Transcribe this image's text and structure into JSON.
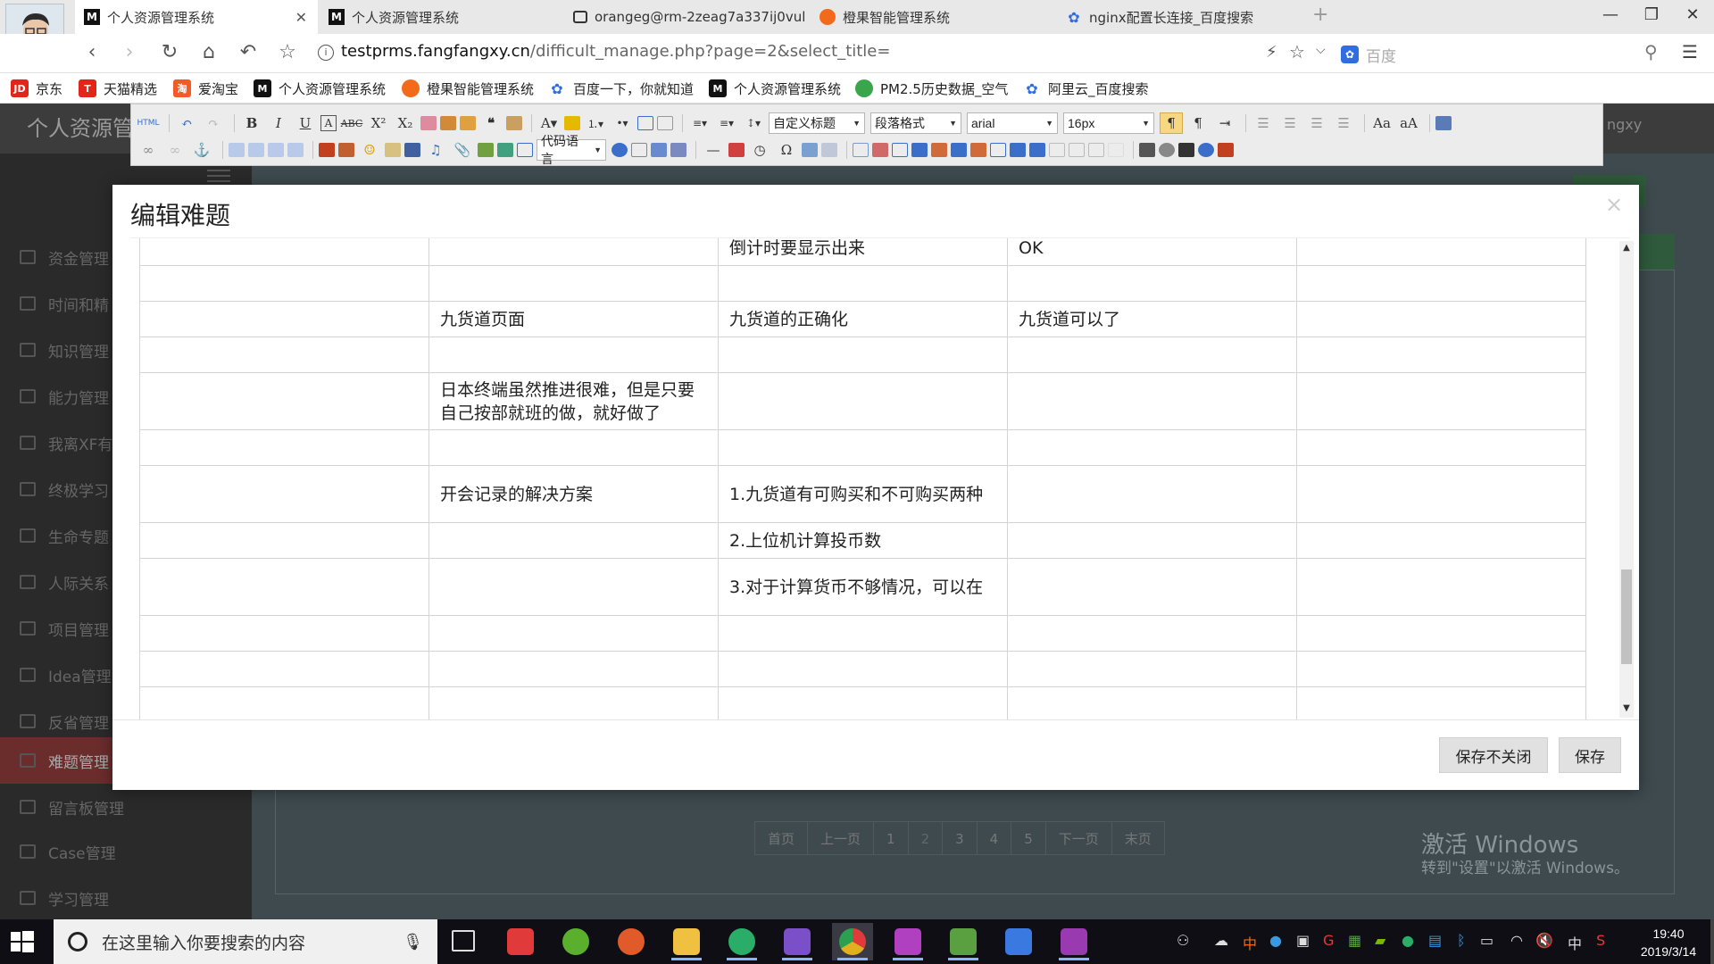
{
  "browser": {
    "tabs": [
      {
        "title": "个人资源管理系统",
        "icon": "m-logo-icon",
        "active": true
      },
      {
        "title": "个人资源管理系统",
        "icon": "m-logo-icon",
        "active": false
      },
      {
        "title": "orangeg@rm-2zeag7a337ij0vul",
        "icon": "console-icon",
        "active": false
      },
      {
        "title": "橙果智能管理系统",
        "icon": "orange-icon",
        "active": false
      },
      {
        "title": "nginx配置长连接_百度搜索",
        "icon": "baidu-paw-icon",
        "active": false
      }
    ],
    "new_tab": "+",
    "url_host": "testprms.fangfangxy.cn",
    "url_path": "/difficult_manage.php?page=2&select_title=",
    "search_placeholder": "百度",
    "bookmarks": [
      {
        "label": "京东",
        "icon": "jd-icon",
        "color": "#e1251b"
      },
      {
        "label": "天猫精选",
        "icon": "tmall-icon",
        "color": "#e1251b"
      },
      {
        "label": "爱淘宝",
        "icon": "taobao-icon",
        "color": "#f25a29"
      },
      {
        "label": "个人资源管理系统",
        "icon": "m-logo-icon",
        "color": "#111111"
      },
      {
        "label": "橙果智能管理系统",
        "icon": "orange-icon",
        "color": "#f26a1b"
      },
      {
        "label": "百度一下，你就知道",
        "icon": "baidu-paw-icon",
        "color": "#2f6ee0"
      },
      {
        "label": "个人资源管理系统",
        "icon": "m-logo-icon",
        "color": "#111111"
      },
      {
        "label": "PM2.5历史数据_空气",
        "icon": "globe-icon",
        "color": "#3aa64b"
      },
      {
        "label": "阿里云_百度搜索",
        "icon": "baidu-paw-icon",
        "color": "#2f6ee0"
      }
    ]
  },
  "app": {
    "title": "个人资源管",
    "user": "ngxy",
    "sidebar": [
      {
        "label": "资金管理",
        "active": false
      },
      {
        "label": "时间和精",
        "active": false
      },
      {
        "label": "知识管理",
        "active": false
      },
      {
        "label": "能力管理",
        "active": false
      },
      {
        "label": "我离XF有",
        "active": false
      },
      {
        "label": "终极学习",
        "active": false
      },
      {
        "label": "生命专题",
        "active": false
      },
      {
        "label": "人际关系",
        "active": false
      },
      {
        "label": "项目管理",
        "active": false
      },
      {
        "label": "Idea管理",
        "active": false
      },
      {
        "label": "反省管理",
        "active": false
      },
      {
        "label": "难题管理",
        "active": true
      },
      {
        "label": "留言板管理",
        "active": false
      },
      {
        "label": "Case管理",
        "active": false
      },
      {
        "label": "学习管理",
        "active": false
      }
    ],
    "pager": [
      "首页",
      "上一页",
      "1",
      "2",
      "3",
      "4",
      "5",
      "下一页",
      "末页"
    ]
  },
  "editor": {
    "toolbar_selects": {
      "heading": "自定义标题",
      "paragraph": "段落格式",
      "font": "arial",
      "size": "16px",
      "code": "代码语言"
    }
  },
  "modal": {
    "title": "编辑难题",
    "close": "×",
    "rows": [
      [
        "",
        "",
        "倒计时要显示出来",
        "OK",
        ""
      ],
      [
        "",
        "",
        "",
        "",
        ""
      ],
      [
        "",
        "九货道页面",
        "九货道的正确化",
        "九货道可以了",
        ""
      ],
      [
        "",
        "",
        "",
        "",
        ""
      ],
      [
        "",
        "日本终端虽然推进很难，但是只要自己按部就班的做，就好做了",
        "",
        "",
        ""
      ],
      [
        "",
        "",
        "",
        "",
        ""
      ],
      [
        "",
        "开会记录的解决方案",
        "1.九货道有可购买和不可购买两种",
        "",
        ""
      ],
      [
        "",
        "",
        "2.上位机计算投币数",
        "",
        ""
      ],
      [
        "",
        "",
        "3.对于计算货币不够情况，可以在",
        "",
        ""
      ],
      [
        "",
        "",
        "",
        "",
        ""
      ],
      [
        "",
        "",
        "",
        "",
        ""
      ],
      [
        "",
        "",
        "",
        "",
        ""
      ],
      [
        "",
        "",
        "",
        "",
        ""
      ]
    ],
    "save_no_close": "保存不关闭",
    "save": "保存"
  },
  "watermark": {
    "line1": "激活 Windows",
    "line2": "转到\"设置\"以激活 Windows。"
  },
  "taskbar": {
    "search_placeholder": "在这里输入你要搜索的内容",
    "apps": [
      {
        "icon": "red-g-icon",
        "color": "#e03a3a"
      },
      {
        "icon": "green-leaf-icon",
        "color": "#5ab02c"
      },
      {
        "icon": "red-snail-icon",
        "color": "#e05a2a"
      },
      {
        "icon": "folder-icon",
        "color": "#f0c040"
      },
      {
        "icon": "wechat-icon",
        "color": "#2aae67"
      },
      {
        "icon": "visual-studio-icon",
        "color": "#7a4fc8"
      },
      {
        "icon": "chrome-icon",
        "color": "#e0b020"
      },
      {
        "icon": "phpstorm-icon",
        "color": "#b040c0"
      },
      {
        "icon": "notepad-icon",
        "color": "#5aa040"
      },
      {
        "icon": "wps-icon",
        "color": "#3a7ae0"
      },
      {
        "icon": "axure-rp-icon",
        "color": "#9a3ab0"
      }
    ],
    "ime": "中",
    "time": "19:40",
    "date": "2019/3/14"
  }
}
